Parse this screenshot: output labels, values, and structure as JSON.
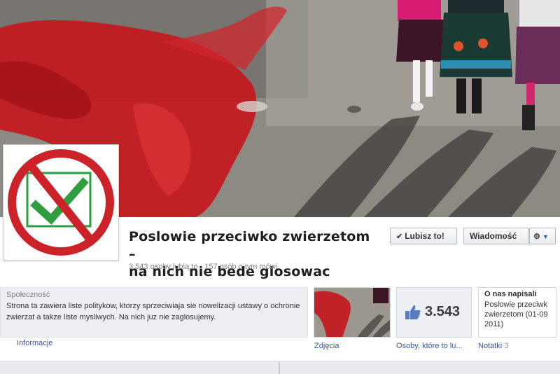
{
  "page": {
    "title_line1": "Poslowie przeciwko zwierzetom –",
    "title_line2": "na nich nie bede glosowac",
    "stats": "3.543 osoby lubią to · 157 osób o tym mówi"
  },
  "actions": {
    "like_label": "Lubisz to!",
    "message_label": "Wiadomość"
  },
  "about": {
    "category": "Społeczność",
    "description": "Strona ta zawiera liste politykow, ktorzy sprzeciwiaja sie nowelizacji ustawy o ochronie zwierzat a takze liste mysliwych. Na nich juz nie zaglosujemy."
  },
  "tiles": {
    "likes_count": "3.543",
    "notes_title": "O nas napisali",
    "notes_item_line1": "Poslowie przeciwk",
    "notes_item_line2": "zwierzetom (01-09",
    "notes_item_line3": "2011)"
  },
  "captions": {
    "info": "Informacje",
    "photos": "Zdjęcia",
    "likes": "Osoby, które to lu...",
    "notes": "Notatki",
    "notes_count": "3"
  },
  "colors": {
    "link": "#3b5998",
    "logo_red": "#cc2229",
    "logo_green": "#2e9e3e"
  },
  "icons": {
    "like_button": "check-icon",
    "settings": "gear-icon",
    "likes_tile": "thumbs-up-icon"
  }
}
